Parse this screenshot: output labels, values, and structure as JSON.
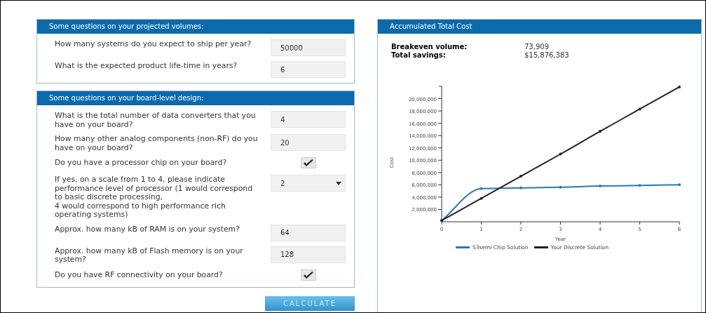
{
  "volume_panel": {
    "title": "Some questions on your projected volumes:",
    "questions": [
      {
        "kind": "text",
        "label": "How many systems do you expect to ship per year?",
        "value": "50000"
      },
      {
        "kind": "text",
        "label": "What is the expected product life-time in years?",
        "value": "6"
      }
    ]
  },
  "design_panel": {
    "title": "Some questions on your board-level design:",
    "questions": [
      {
        "kind": "text",
        "label": "What is the total number of data converters that you have on your board?",
        "value": "4"
      },
      {
        "kind": "text",
        "label": "How many other analog components (non-RF) do you have on your board?",
        "value": "20"
      },
      {
        "kind": "check",
        "label": "Do you have a processor chip on your board?",
        "checked": true
      },
      {
        "kind": "select",
        "label": "If yes, on a scale from 1 to 4, please indicate performance level of processor (1 would correspond to basic discrete processing,\n4 would correspond to high performance rich operating systems)",
        "value": "2"
      },
      {
        "kind": "text",
        "label": "Approx. how many kB of RAM is on your system?",
        "value": "64"
      },
      {
        "kind": "text",
        "label": "Approx. how many kB of Flash memory is on your system?",
        "value": "128"
      },
      {
        "kind": "check",
        "label": "Do you have RF connectivity on your board?",
        "checked": true
      }
    ]
  },
  "calculate_button": "CALCULATE",
  "result_panel": {
    "title": "Accumulated Total Cost",
    "summary": [
      {
        "label": "Breakeven volume:",
        "value": "73,909"
      },
      {
        "label": "Total savings:",
        "value": "$15,876,383"
      }
    ],
    "chart_data": {
      "type": "line",
      "legend": true,
      "xlabel": "Year",
      "ylabel": "Cost",
      "x": [
        0,
        1,
        2,
        3,
        4,
        5,
        6
      ],
      "xlim": [
        0,
        6
      ],
      "ylim": [
        0,
        22000000
      ],
      "xticks": [
        {
          "value": 0,
          "label": "0"
        },
        {
          "value": 1,
          "label": "1"
        },
        {
          "value": 2,
          "label": "2"
        },
        {
          "value": 3,
          "label": "3"
        },
        {
          "value": 4,
          "label": "4"
        },
        {
          "value": 5,
          "label": "5"
        },
        {
          "value": 6,
          "label": "6"
        }
      ],
      "yticks": [
        {
          "value": 2000000,
          "label": "2,000,000"
        },
        {
          "value": 4000000,
          "label": "4,000,000"
        },
        {
          "value": 6000000,
          "label": "6,000,000"
        },
        {
          "value": 8000000,
          "label": "8,000,000"
        },
        {
          "value": 10000000,
          "label": "10,000,000"
        },
        {
          "value": 12000000,
          "label": "12,000,000"
        },
        {
          "value": 14000000,
          "label": "14,000,000"
        },
        {
          "value": 16000000,
          "label": "16,000,000"
        },
        {
          "value": 18000000,
          "label": "18,000,000"
        },
        {
          "value": 20000000,
          "label": "20,000,000"
        }
      ],
      "series": [
        {
          "name": "S3semi Chip Solution",
          "color": "#2a7ab0",
          "values": [
            200000,
            5400000,
            5500000,
            5600000,
            5800000,
            5900000,
            6000000
          ]
        },
        {
          "name": "Your Discrete Solution",
          "color": "#222222",
          "values": [
            200000,
            3800000,
            7400000,
            11000000,
            14700000,
            18300000,
            21900000
          ]
        }
      ]
    }
  }
}
